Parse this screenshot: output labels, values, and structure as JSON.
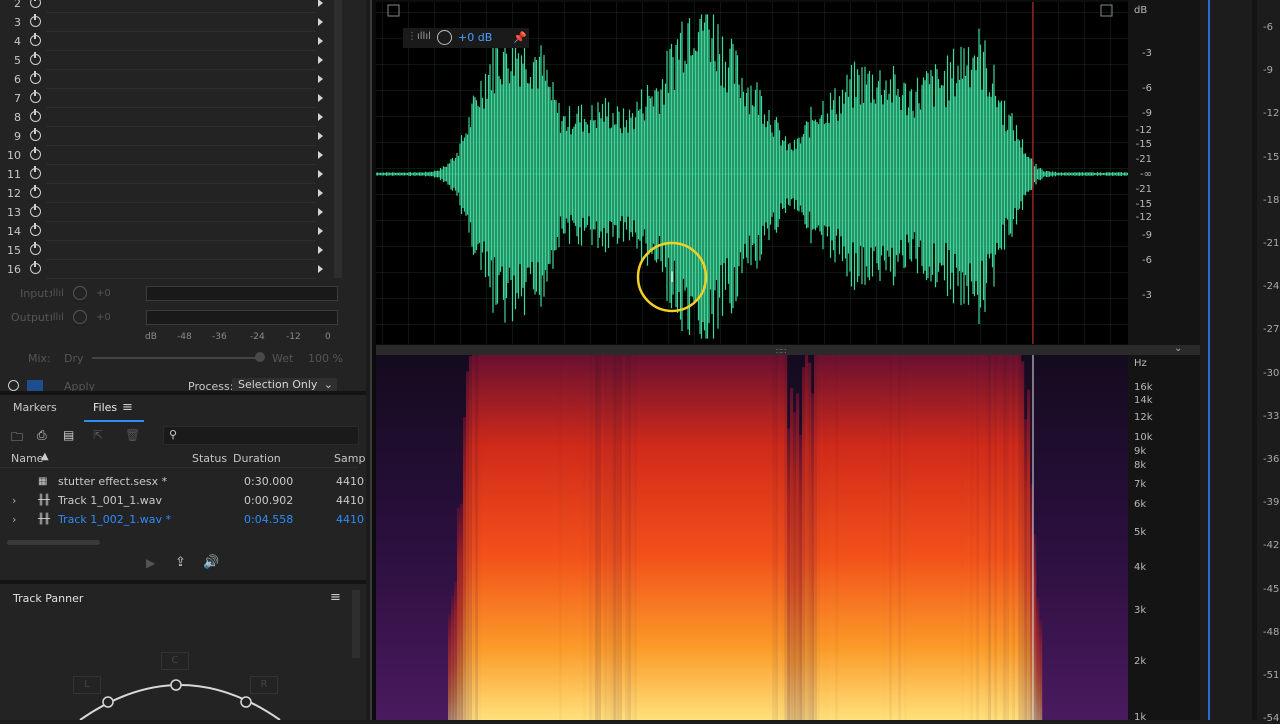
{
  "effects_rack": {
    "slots": [
      "2",
      "3",
      "4",
      "5",
      "6",
      "7",
      "8",
      "9",
      "10",
      "11",
      "12",
      "13",
      "14",
      "15",
      "16"
    ],
    "input_label": "Input:",
    "input_value": "+0",
    "output_label": "Output:",
    "output_value": "+0",
    "meter_scale": [
      "dB",
      "-48",
      "-36",
      "-24",
      "-12",
      "0"
    ],
    "mix_label": "Mix:",
    "dry_label": "Dry",
    "wet_label": "Wet",
    "wet_value": "100 %",
    "apply_label": "Apply",
    "process_label": "Process:",
    "process_value": "Selection Only"
  },
  "files_panel": {
    "tabs": [
      "Markers",
      "Files"
    ],
    "columns": [
      "Name",
      "Status",
      "Duration",
      "Samp"
    ],
    "rows": [
      {
        "name": "stutter effect.sesx *",
        "duration": "0:30.000",
        "sample_rate": "4410",
        "type": "session"
      },
      {
        "name": "Track 1_001_1.wav",
        "duration": "0:00.902",
        "sample_rate": "4410",
        "type": "audio"
      },
      {
        "name": "Track 1_002_1.wav *",
        "duration": "0:04.558",
        "sample_rate": "4410",
        "type": "audio",
        "selected": true
      }
    ]
  },
  "track_panner": {
    "title": "Track Panner",
    "labels": {
      "center": "C",
      "left": "L",
      "right": "R"
    }
  },
  "waveform": {
    "hud_gain": "+0 dB",
    "db_ticks": [
      "dB",
      "-3",
      "-6",
      "-9",
      "-12",
      "-15",
      "-21",
      "-∞",
      "-21",
      "-15",
      "-12",
      "-9",
      "-6",
      "-3"
    ]
  },
  "spectrum": {
    "hz_ticks": [
      "Hz",
      "16k",
      "14k",
      "12k",
      "10k",
      "9k",
      "8k",
      "7k",
      "6k",
      "5k",
      "4k",
      "3k",
      "2k",
      "1k"
    ]
  },
  "level_meter": {
    "ticks": [
      "-6",
      "-9",
      "-12",
      "-15",
      "-18",
      "-21",
      "-24",
      "-27",
      "-30",
      "-33",
      "-36",
      "-39",
      "-42",
      "-45",
      "-48",
      "-51",
      "-54"
    ]
  },
  "colors": {
    "waveform": "#3dd79a",
    "selection": "#2b8dfc",
    "playhead": "#d11f1f",
    "cursor_ring": "#f2d024"
  }
}
